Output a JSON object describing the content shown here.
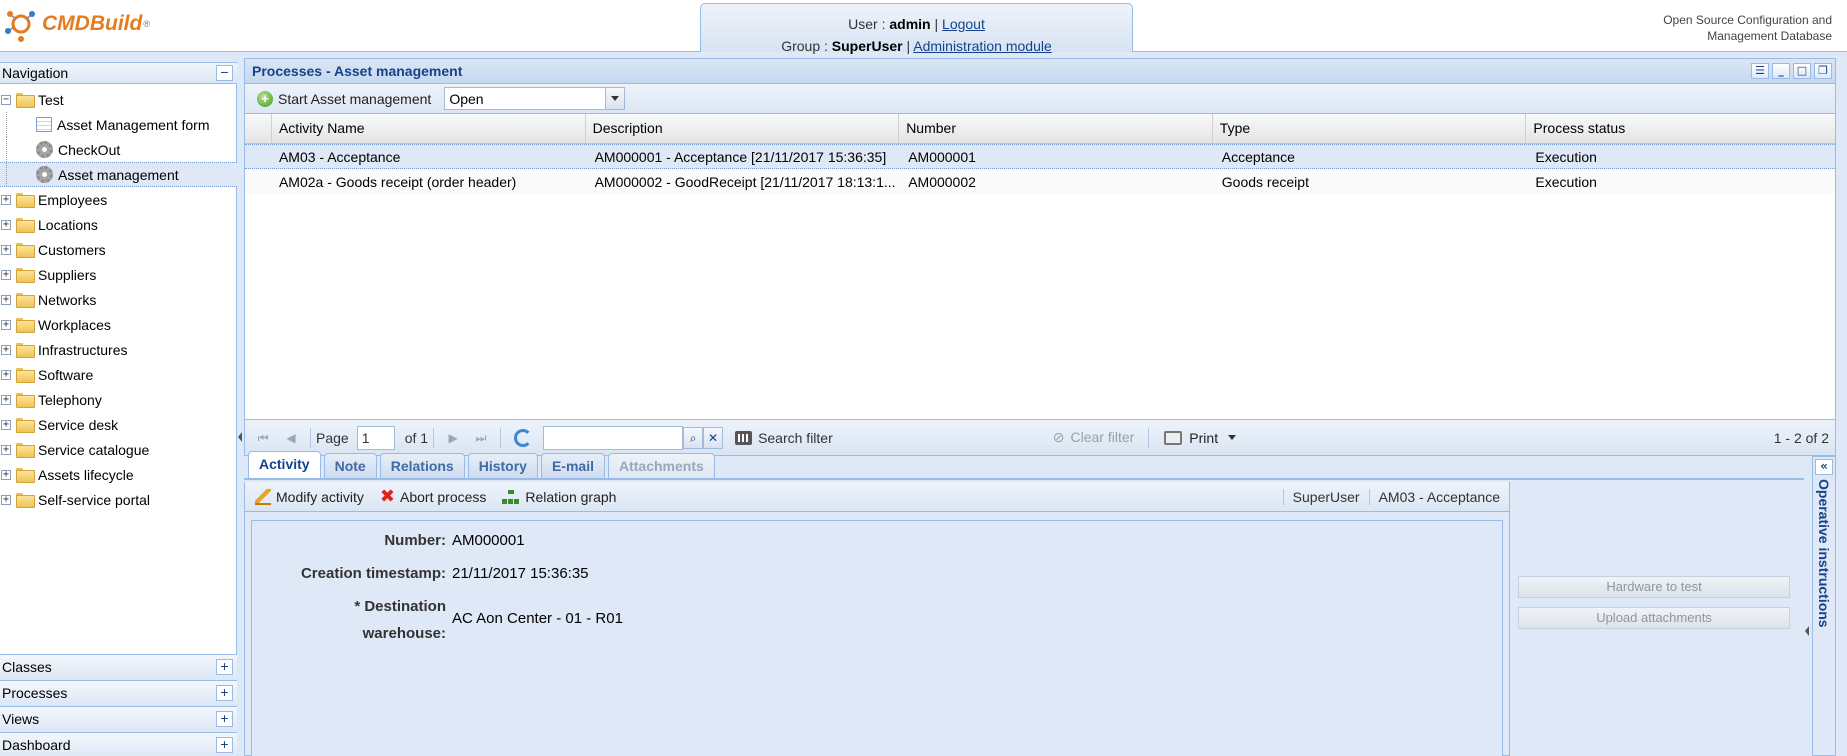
{
  "header": {
    "logo_text": "CMDBuild",
    "user_label": "User :",
    "user_name": "admin",
    "logout": "Logout",
    "group_label": "Group :",
    "group_name": "SuperUser",
    "admin_link": "Administration module",
    "tagline_line1": "Open Source Configuration and",
    "tagline_line2": "Management Database"
  },
  "navigation": {
    "title": "Navigation",
    "collapse_icon": "minus",
    "tree": [
      {
        "label": "Test",
        "expanded": true
      },
      {
        "label": "Asset Management form",
        "icon": "form-icon"
      },
      {
        "label": "CheckOut",
        "icon": "gear-icon"
      },
      {
        "label": "Asset management",
        "icon": "gear-icon",
        "selected": true
      },
      {
        "label": "Employees"
      },
      {
        "label": "Locations"
      },
      {
        "label": "Customers"
      },
      {
        "label": "Suppliers"
      },
      {
        "label": "Networks"
      },
      {
        "label": "Workplaces"
      },
      {
        "label": "Infrastructures"
      },
      {
        "label": "Software"
      },
      {
        "label": "Telephony"
      },
      {
        "label": "Service desk"
      },
      {
        "label": "Service catalogue"
      },
      {
        "label": "Assets lifecycle"
      },
      {
        "label": "Self-service portal"
      }
    ],
    "bottom_sections": [
      "Classes",
      "Processes",
      "Views",
      "Dashboard"
    ]
  },
  "main": {
    "title": "Processes - Asset management",
    "start_button": "Start Asset management",
    "status_filter": "Open",
    "columns": [
      "Activity Name",
      "Description",
      "Number",
      "Type",
      "Process status"
    ],
    "rows": [
      [
        "AM03 - Acceptance",
        "AM000001 - Acceptance [21/11/2017 15:36:35]",
        "AM000001",
        "Acceptance",
        "Execution"
      ],
      [
        "AM02a - Goods receipt (order header)",
        "AM000002 - GoodReceipt [21/11/2017 18:13:1...",
        "AM000002",
        "Goods receipt",
        "Execution"
      ]
    ],
    "paging": {
      "page_label": "Page",
      "page_value": "1",
      "of_label": "of 1",
      "search_placeholder": "",
      "search_filter": "Search filter",
      "clear_filter": "Clear filter",
      "print": "Print",
      "summary": "1 - 2 of 2"
    }
  },
  "detail": {
    "tabs": [
      "Activity",
      "Note",
      "Relations",
      "History",
      "E-mail",
      "Attachments"
    ],
    "toolbar": {
      "modify": "Modify activity",
      "abort": "Abort process",
      "graph": "Relation graph",
      "performer": "SuperUser",
      "current_activity": "AM03 - Acceptance"
    },
    "fields": [
      {
        "label": "Number:",
        "value": "AM000001"
      },
      {
        "label": "Creation timestamp:",
        "value": "21/11/2017 15:36:35"
      },
      {
        "label_line1": "* Destination",
        "label_line2": "warehouse:",
        "value": "AC Aon Center - 01 - R01"
      }
    ],
    "side_buttons": [
      "Hardware to test",
      "Upload attachments"
    ],
    "instructions_title": "Operative instructions"
  }
}
